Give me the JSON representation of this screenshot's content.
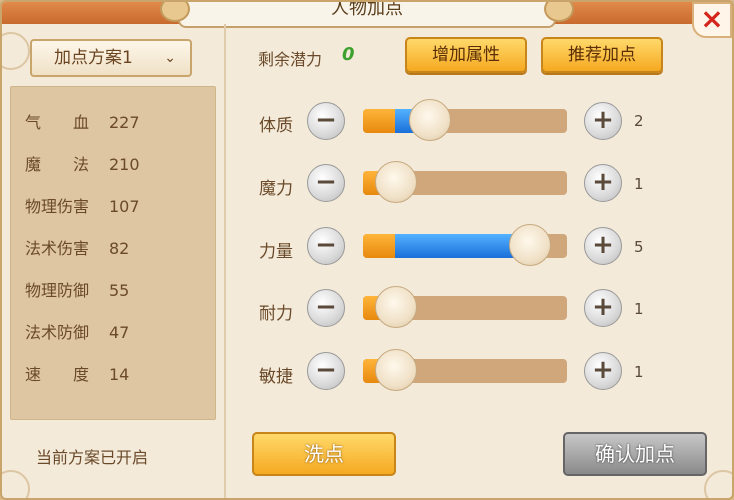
{
  "title": "人物加点",
  "close_label": "×",
  "scheme": {
    "label": "加点方案1",
    "chevron": "⌄"
  },
  "stats": [
    {
      "name": "气　　血",
      "value": "227"
    },
    {
      "name": "魔　　法",
      "value": "210"
    },
    {
      "name": "物理伤害",
      "value": "107"
    },
    {
      "name": "法术伤害",
      "value": "82"
    },
    {
      "name": "物理防御",
      "value": "55"
    },
    {
      "name": "法术防御",
      "value": "47"
    },
    {
      "name": "速　　度",
      "value": "14"
    }
  ],
  "status_text": "当前方案已开启",
  "remaining": {
    "label": "剩余潜力",
    "value": "0"
  },
  "buttons": {
    "add_attr": "增加属性",
    "recommend": "推荐加点",
    "wash": "洗点",
    "confirm": "确认加点"
  },
  "attributes": [
    {
      "label": "体质",
      "points": "2",
      "level": 0.33
    },
    {
      "label": "魔力",
      "points": "1",
      "level": 0.16
    },
    {
      "label": "力量",
      "points": "5",
      "level": 0.82
    },
    {
      "label": "耐力",
      "points": "1",
      "level": 0.16
    },
    {
      "label": "敏捷",
      "points": "1",
      "level": 0.16
    }
  ],
  "minus_glyph": "−",
  "plus_glyph": "+"
}
